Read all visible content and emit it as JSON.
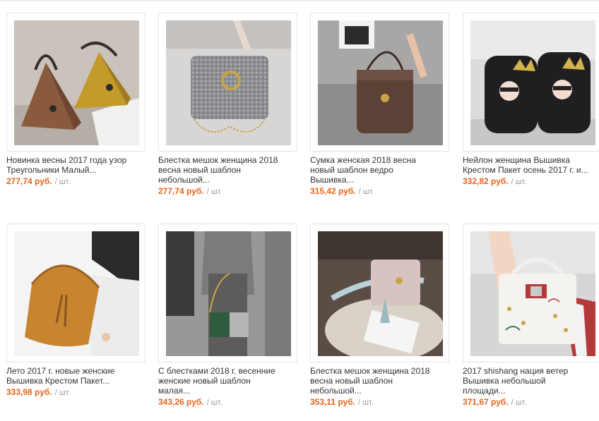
{
  "theme": {
    "price_color": "#e8641b",
    "unit_color": "#999999",
    "border_color": "#e3e3e3"
  },
  "products": [
    {
      "title": "Новинка весны 2017 года узор\nТреугольники Малый...",
      "price": "277,74 руб.",
      "unit": "/ шт.",
      "image": "pyramid-bags-brown-yellow"
    },
    {
      "title": "Блестка мешок женщина 2018\nвесна новый шаблон\nнебольшой...",
      "price": "277,74 руб.",
      "unit": "/ шт.",
      "image": "silver-glitter-chain-bag"
    },
    {
      "title": "Сумка женская 2018 весна\nновый шаблон ведро\nВышивка...",
      "price": "315,42 руб.",
      "unit": "/ шт.",
      "image": "bronze-bucket-bag"
    },
    {
      "title": "Нейлон женщина Вышивка\nКрестом Пакет осень 2017 г. и...",
      "price": "332,82 руб.",
      "unit": "/ шт.",
      "image": "crown-face-backpacks"
    },
    {
      "title": "Лето 2017 г. новые женские\nВышивка Крестом Пакет...",
      "price": "333,98 руб.",
      "unit": "/ шт.",
      "image": "tan-hobo-tassel-bag"
    },
    {
      "title": "С блестками 2018 г. весенние\nженские новый шаблон\nмалая...",
      "price": "343,26 руб.",
      "unit": "/ шт.",
      "image": "green-glitter-crossbody"
    },
    {
      "title": "Блестка мешок женщина 2018\nвесна новый шаблон\nнебольшой...",
      "price": "353,11 руб.",
      "unit": "/ шт.",
      "image": "pink-glitter-tassel-bag"
    },
    {
      "title": "2017 shishang нация ветер\nВышивка небольшой\nплощади...",
      "price": "371,67 руб.",
      "unit": "/ шт.",
      "image": "white-embroidered-studded-bag"
    }
  ]
}
